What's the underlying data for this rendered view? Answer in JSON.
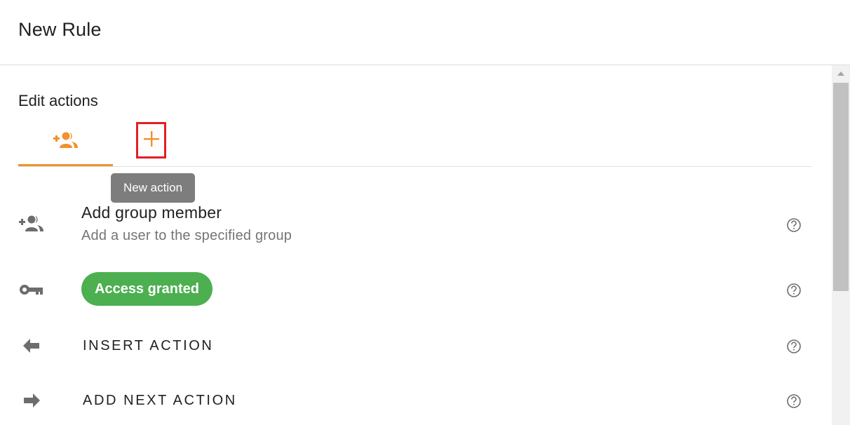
{
  "header": {
    "title": "New Rule"
  },
  "section": {
    "title": "Edit actions"
  },
  "tabs": [
    {
      "name": "add-group-member-tab",
      "icon": "group-add-icon",
      "active": true
    },
    {
      "name": "new-action-tab",
      "icon": "plus-icon",
      "active": false
    }
  ],
  "tooltip": {
    "text": "New action"
  },
  "rows": {
    "action": {
      "icon": "group-add-icon",
      "title": "Add group member",
      "subtitle": "Add a user to the specified group",
      "help_icon": "help-circle-icon"
    },
    "status": {
      "icon": "key-icon",
      "badge": "Access granted",
      "help_icon": "help-circle-icon"
    },
    "insert": {
      "icon": "arrow-left-icon",
      "label": "INSERT ACTION",
      "help_icon": "help-circle-icon"
    },
    "next": {
      "icon": "arrow-right-icon",
      "label": "ADD NEXT ACTION",
      "help_icon": "help-circle-icon"
    }
  },
  "colors": {
    "accent": "#f0912e",
    "highlight": "#e21f26",
    "badge": "#4caf50",
    "tooltip": "#7d7d7d",
    "icon": "#6d6d6d"
  }
}
